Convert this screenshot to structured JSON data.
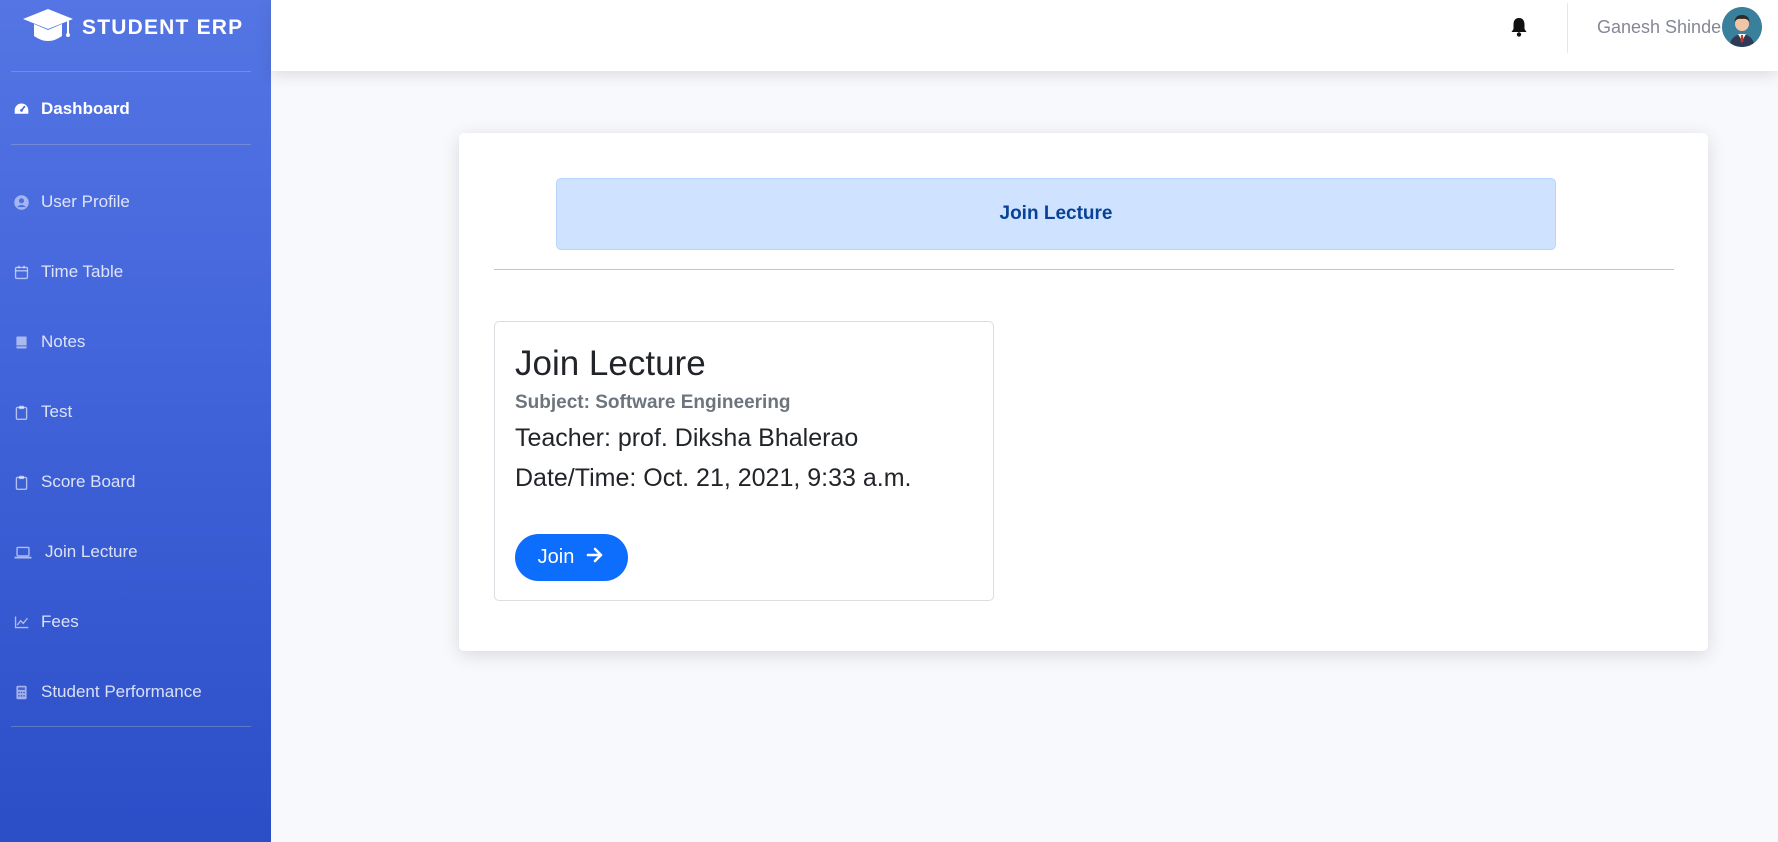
{
  "brand": {
    "name": "STUDENT ERP",
    "icon": "graduation-cap-icon"
  },
  "sidebar": {
    "items": [
      {
        "label": "Dashboard",
        "icon": "tachometer-icon",
        "active": true
      },
      {
        "label": "User Profile",
        "icon": "user-circle-icon"
      },
      {
        "label": "Time Table",
        "icon": "calendar-icon"
      },
      {
        "label": "Notes",
        "icon": "book-icon"
      },
      {
        "label": "Test",
        "icon": "clipboard-icon"
      },
      {
        "label": "Score Board",
        "icon": "clipboard-icon"
      },
      {
        "label": "Join Lecture",
        "icon": "laptop-icon"
      },
      {
        "label": "Fees",
        "icon": "chart-line-icon"
      },
      {
        "label": "Student Performance",
        "icon": "calculator-icon"
      }
    ]
  },
  "topbar": {
    "user_name": "Ganesh Shinde",
    "bell_icon": "bell-icon",
    "avatar": "avatar"
  },
  "main": {
    "alert": "Join Lecture",
    "lecture": {
      "title": "Join Lecture",
      "subject": "Subject: Software Engineering",
      "teacher": "Teacher: prof. Diksha Bhalerao",
      "datetime": "Date/Time: Oct. 21, 2021, 9:33 a.m.",
      "join_label": "Join"
    }
  },
  "colors": {
    "sidebar": "#4e73df",
    "primary": "#0d6efd",
    "alert_bg": "#cfe2ff",
    "alert_text": "#084298"
  }
}
